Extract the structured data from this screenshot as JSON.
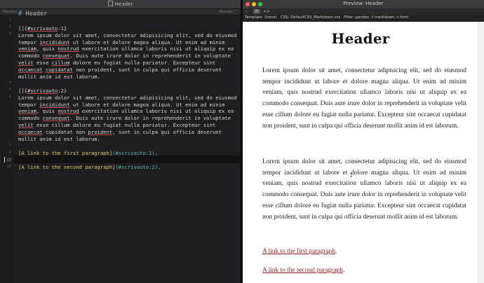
{
  "editor": {
    "title": "Header",
    "breadcrumb_left": "Header",
    "breadcrumb_right": "Header",
    "line_numbers": [
      "1",
      "2",
      "3",
      "4",
      "5",
      "6",
      "7",
      "8",
      "9",
      "10",
      "11"
    ],
    "heading_hash": "#",
    "heading_text": "Header",
    "anchor1_a": "[]{",
    "anchor1_b": "#scrivauto",
    "anchor1_c": ":1}",
    "anchor2_a": "[]{",
    "anchor2_b": "#scrivauto",
    "anchor2_c": ":2}",
    "p1": {
      "l1": "Lorem ipsum dolor sit amet, consectetur adipisicing elit, sed do eiusmod",
      "l2a": "tempor ",
      "l2b": "incididunt",
      "l2c": " ut labore et dolore magna aliqua. Ut enim ad minim",
      "l3a": "veniam",
      "l3b": ", quis ",
      "l3c": "nostrud",
      "l3d": " exercitation ullamco laboris nisi ut aliquip ex ea",
      "l4a": "commodo ",
      "l4b": "consequat",
      "l4c": ". Duis aute irure dolor in reprehenderit in voluptate",
      "l5a": "velit",
      "l5b": " esse ",
      "l5c": "cillum",
      "l5d": " dolore eu fugiat nulla pariatur. Excepteur sint",
      "l6a": "occaecat",
      "l6b": " ",
      "l6c": "cupidatat",
      "l6d": " non proident, sunt in culpa qui officia deserunt",
      "l7": "mollit anim id est laborum."
    },
    "p2": {
      "l1": "Lorem ipsum dolor sit amet, consectetur adipisicing elit, sed do eiusmod",
      "l2a": "tempor ",
      "l2b": "incididunt",
      "l2c": " ut labore et dolore magna aliqua. Ut enim ad minim",
      "l3a": "veniam",
      "l3b": ", quis ",
      "l3c": "nostrud",
      "l3d": " exercitation ullamco laboris nisi ut aliquip ex ea",
      "l4a": "commodo ",
      "l4b": "consequat",
      "l4c": ". Duis aute irure dolor in reprehenderit in voluptate",
      "l5a": "velit",
      "l5b": " esse cillum dolore eu fugiat nulla pariatur. Excepteur sint",
      "l6a": "occaecat",
      "l6b": " cupidatat non ",
      "l6c": "proident",
      "l6d": ", sunt in culpa qui officia deserunt",
      "l7": "mollit anim id est laborum."
    },
    "link1_text": "[A link to the first paragraph]",
    "link1_url": "(#scrivauto:1)",
    "link1_end": ".",
    "link2_text": "[A link to the second paragraph]",
    "link2_url": "(#scrivauto:2)",
    "link2_end": "."
  },
  "preview": {
    "title": "Preview: Header",
    "template_label": "Template: (none)",
    "css_label": "CSS: DefaultCSS_Markdown.css",
    "filter_label": "Filter: pandoc -f markdown -t html",
    "heading": "Header",
    "paragraph1": "Lorem ipsum dolor sit amet, consectetur adipisicing elit, sed do eiusmod tempor incididunt ut labore et dolore magna aliqua. Ut enim ad minim veniam, quis nostrud exercitation ullamco laboris nisi ut aliquip ex ea commodo consequat. Duis aute irure dolor in reprehenderit in voluptate velit esse cillum dolore eu fugiat nulla pariatur. Excepteur sint occaecat cupidatat non proident, sunt in culpa qui officia deserunt mollit anim id est laborum.",
    "paragraph2": "Lorem ipsum dolor sit amet, consectetur adipisicing elit, sed do eiusmod tempor incididunt ut labore et dolore magna aliqua. Ut enim ad minim veniam, quis nostrud exercitation ullamco laboris nisi ut aliquip ex ea commodo consequat. Duis aute irure dolor in reprehenderit in voluptate velit esse cillum dolore eu fugiat nulla pariatur. Excepteur sint occaecat cupidatat non proident, sunt in culpa qui officia deserunt mollit anim id est laborum.",
    "link1": "A link to the first paragraph",
    "link2": "A link to the second paragraph",
    "link_end": "."
  },
  "colors": {
    "traffic_close": "#ff5f57",
    "traffic_min": "#febc2e",
    "traffic_max": "#28c840",
    "link": "#8f1f1f"
  },
  "icons": [
    "document-icon",
    "chevron-icon",
    "back-icon",
    "forward-icon",
    "preview-icon",
    "code-icon"
  ]
}
